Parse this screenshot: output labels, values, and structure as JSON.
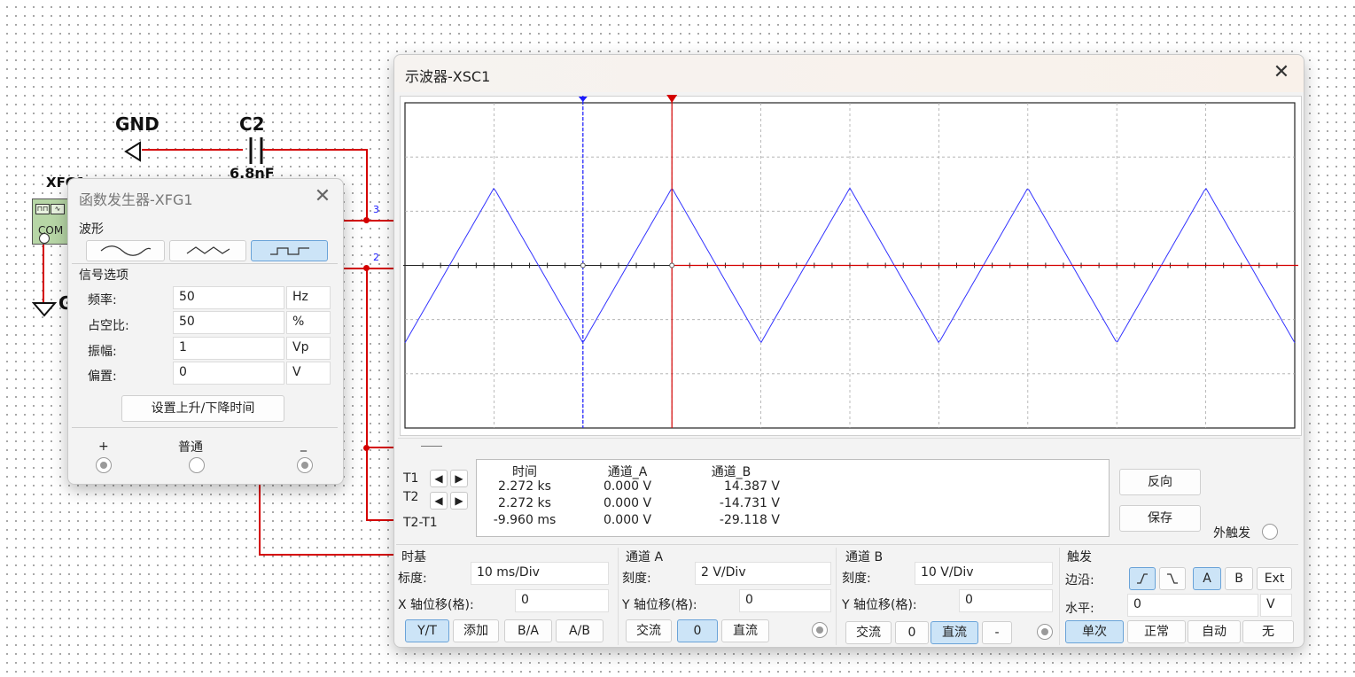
{
  "schematic": {
    "gnd_label": "GND",
    "c2_label": "C2",
    "c2_value": "6.8nF",
    "xfg_label": "XFG1",
    "com_label": "COM",
    "ground_partial": "G",
    "pin3": "3",
    "pin2": "2"
  },
  "func_gen": {
    "title": "函数发生器-XFG1",
    "close_icon": "close-icon",
    "waveform_label": "波形",
    "waveforms": [
      "sine-wave-icon",
      "triangle-wave-icon",
      "square-wave-icon"
    ],
    "selected_waveform": "square-wave-icon",
    "signal_options_label": "信号选项",
    "params": [
      {
        "label": "频率:",
        "value": "50",
        "unit": "Hz"
      },
      {
        "label": "占空比:",
        "value": "50",
        "unit": "%"
      },
      {
        "label": "振幅:",
        "value": "1",
        "unit": "Vp"
      },
      {
        "label": "偏置:",
        "value": "0",
        "unit": "V"
      }
    ],
    "rise_fall_button": "设置上升/下降时间",
    "plus_label": "+",
    "common_label": "普通",
    "minus_label": "_"
  },
  "scope": {
    "title": "示波器-XSC1",
    "readout": {
      "headers": [
        "时间",
        "通道_A",
        "通道_B"
      ],
      "rows": [
        {
          "label": "T1",
          "time": "2.272 ks",
          "a": "0.000 V",
          "b": "14.387 V"
        },
        {
          "label": "T2",
          "time": "2.272 ks",
          "a": "0.000 V",
          "b": "-14.731 V"
        },
        {
          "label": "T2-T1",
          "time": "-9.960 ms",
          "a": "0.000 V",
          "b": "-29.118 V"
        }
      ]
    },
    "reverse_button": "反向",
    "save_button": "保存",
    "ext_trigger_label": "外触发",
    "timebase": {
      "title": "时基",
      "scale_label": "标度:",
      "scale_value": "10 ms/Div",
      "xpos_label": "X 轴位移(格):",
      "xpos_value": "0",
      "buttons": [
        "Y/T",
        "添加",
        "B/A",
        "A/B"
      ],
      "selected": "Y/T"
    },
    "channel_a": {
      "title": "通道 A",
      "scale_label": "刻度:",
      "scale_value": "2  V/Div",
      "ypos_label": "Y 轴位移(格):",
      "ypos_value": "0",
      "buttons": [
        "交流",
        "0",
        "直流"
      ],
      "selected": "0"
    },
    "channel_b": {
      "title": "通道 B",
      "scale_label": "刻度:",
      "scale_value": "10  V/Div",
      "ypos_label": "Y 轴位移(格):",
      "ypos_value": "0",
      "buttons": [
        "交流",
        "0",
        "直流",
        "-"
      ],
      "selected": "直流"
    },
    "trigger": {
      "title": "触发",
      "edge_label": "边沿:",
      "edge_buttons": [
        "rising-edge-icon",
        "falling-edge-icon"
      ],
      "source_buttons": [
        "A",
        "B",
        "Ext"
      ],
      "selected_source": "A",
      "level_label": "水平:",
      "level_value": "0",
      "level_unit": "V",
      "mode_buttons": [
        "单次",
        "正常",
        "自动",
        "无"
      ],
      "selected_mode": "单次"
    },
    "colors": {
      "trace_b": "#3333ff",
      "trace_a": "#d40000",
      "cursor_t1": "#1a1aff",
      "cursor_t2": "#d40000"
    }
  }
}
